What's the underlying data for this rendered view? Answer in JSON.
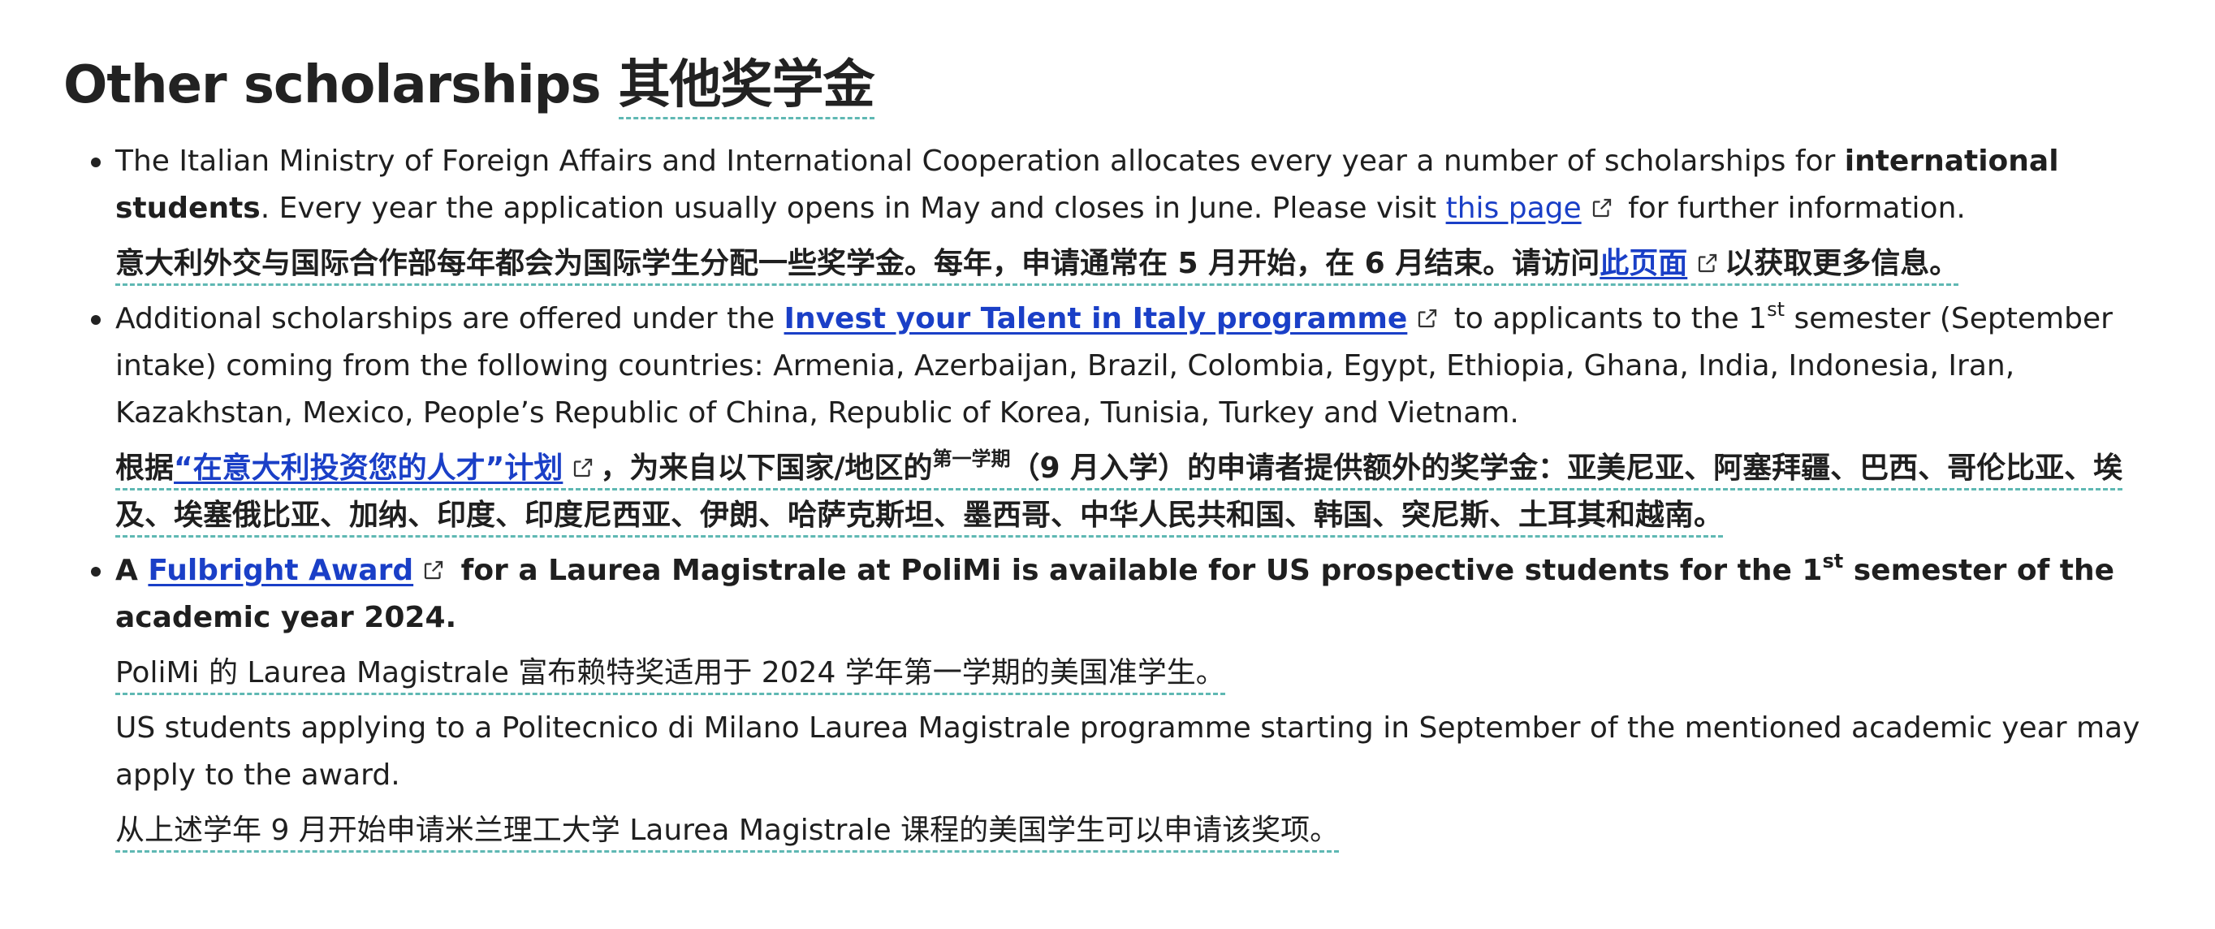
{
  "heading": {
    "en": "Other scholarships",
    "zh": "其他奖学金"
  },
  "items": [
    {
      "en": {
        "t1": "The Italian Ministry of Foreign Affairs and International Cooperation allocates every year a number of scholarships for ",
        "bold1": "international students",
        "t2": ". Every year the application usually opens in May and closes in June. Please visit ",
        "link": "this page",
        "t3": " for further information."
      },
      "zh": {
        "t1": "意大利外交与国际合作部每年都会为国际学生分配一些奖学金。每年，申请通常在 5 月开始，在 6 月结束。请访问",
        "link": "此页面",
        "t2": "以获取更多信息。"
      }
    },
    {
      "en": {
        "t1": "Additional scholarships are offered under the ",
        "link": "Invest your Talent in Italy programme",
        "t2": " to applicants to the 1",
        "sup": "st",
        "t3": " semester (September intake) coming from the following countries: Armenia, Azerbaijan, Brazil, Colombia, Egypt, Ethiopia, Ghana, India, Indonesia, Iran, Kazakhstan, Mexico, People’s Republic of China, Republic of Korea, Tunisia, Turkey and Vietnam."
      },
      "zh": {
        "t1": "根据",
        "link": "“在意大利投资您的人才”计划",
        "t2": "，为来自以下国家/地区的",
        "small": "第一学期",
        "t3": "（9 月入学）的申请者提供额外的奖学金：亚美尼亚、阿塞拜疆、巴西、哥伦比亚、埃及、埃塞俄比亚、加纳、印度、印度尼西亚、伊朗、哈萨克斯坦、墨西哥、中华人民共和国、韩国、突尼斯、土耳其和越南。"
      }
    },
    {
      "en": {
        "t1": "A ",
        "link": "Fulbright Award",
        "t2": " for a Laurea Magistrale at PoliMi is available for US prospective students for the 1",
        "sup": "st",
        "t3": " semester of the academic year 2024."
      },
      "zh": {
        "t1": "PoliMi 的 Laurea Magistrale 富布赖特奖适用于 2024 学年第一学期的美国准学生。"
      },
      "en2": "US students applying to a Politecnico di Milano Laurea Magistrale programme starting in September of the mentioned academic year may apply to the award.",
      "zh2": "从上述学年 9 月开始申请米兰理工大学 Laurea Magistrale 课程的美国学生可以申请该奖项。"
    }
  ],
  "icons": {
    "external_link": "external-link-icon"
  },
  "colors": {
    "link": "#1a3fc7",
    "translation_underline": "#5fb8b3",
    "text": "#1f1f1f"
  }
}
